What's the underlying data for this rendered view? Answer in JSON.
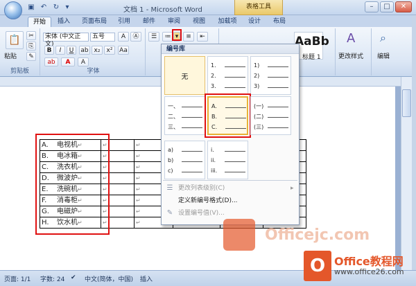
{
  "window": {
    "title": "文档 1 - Microsoft Word",
    "context_tab": "表格工具",
    "minimize": "–",
    "maximize": "□",
    "close": "✕"
  },
  "tabs": [
    "开始",
    "插入",
    "页面布局",
    "引用",
    "邮件",
    "审阅",
    "视图",
    "加载项",
    "设计",
    "布局"
  ],
  "ribbon": {
    "clipboard": {
      "label": "剪贴板",
      "paste": "粘贴"
    },
    "font": {
      "label": "字体",
      "name": "宋体 (中文正文)",
      "size": "五号",
      "bold": "B",
      "italic": "I",
      "underline": "U"
    },
    "styles": {
      "title_style": "标题 1",
      "preview_big": "AaBb",
      "change_styles": "更改样式"
    },
    "editing": {
      "label": "编辑"
    }
  },
  "numbering_library": {
    "title": "编号库",
    "none_label": "无",
    "formats": [
      [
        "1.",
        "2.",
        "3."
      ],
      [
        "1)",
        "2)",
        "3)"
      ],
      [
        "一、",
        "二、",
        "三、"
      ],
      [
        "A.",
        "B.",
        "C."
      ],
      [
        "(一)",
        "(二)",
        "(三)"
      ],
      [
        "a)",
        "b)",
        "c)"
      ],
      [
        "i.",
        "ii.",
        "iii."
      ]
    ],
    "menu": {
      "change_level": "更改列表级别(C)",
      "define_new": "定义新编号格式(D)...",
      "set_value": "设置编号值(V)..."
    }
  },
  "document_table": {
    "rows": [
      {
        "letter": "A.",
        "text": "电视机"
      },
      {
        "letter": "B.",
        "text": "电冰箱"
      },
      {
        "letter": "C.",
        "text": "洗衣机"
      },
      {
        "letter": "D.",
        "text": "微波炉"
      },
      {
        "letter": "E.",
        "text": "洗碗机"
      },
      {
        "letter": "F.",
        "text": "消毒柜"
      },
      {
        "letter": "G.",
        "text": "电磁炉"
      },
      {
        "letter": "H.",
        "text": "饮水机"
      }
    ],
    "cell_mark": "↵"
  },
  "statusbar": {
    "page": "页面: 1/1",
    "words": "字数: 24",
    "language": "中文(简体，中国)",
    "mode": "插入"
  },
  "watermark": {
    "text": "Officejc.com"
  },
  "brand": {
    "icon": "O",
    "name": "Office教程网",
    "url": "www.office26.com"
  },
  "colors": {
    "accent_red": "#e01010",
    "office_orange": "#e4572a",
    "ribbon_blue": "#dce7f5"
  }
}
